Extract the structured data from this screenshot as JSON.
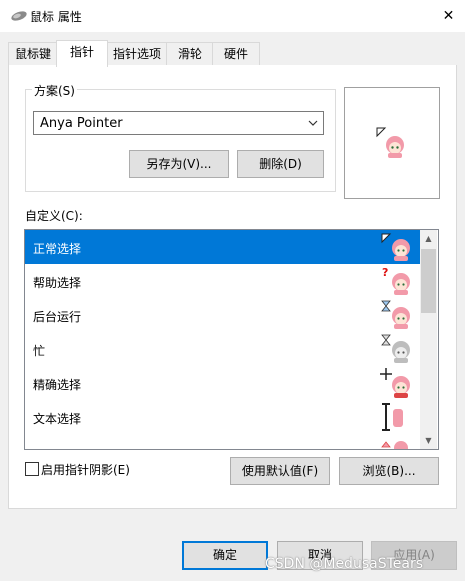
{
  "window": {
    "title": "鼠标 属性",
    "close_glyph": "✕"
  },
  "tabs": [
    {
      "label": "鼠标键",
      "active": false
    },
    {
      "label": "指针",
      "active": true
    },
    {
      "label": "指针选项",
      "active": false
    },
    {
      "label": "滑轮",
      "active": false
    },
    {
      "label": "硬件",
      "active": false
    }
  ],
  "scheme": {
    "label": "方案(S)",
    "selected": "Anya Pointer",
    "save_as": "另存为(V)...",
    "delete": "删除(D)"
  },
  "custom": {
    "label": "自定义(C):",
    "items": [
      {
        "label": "正常选择",
        "selected": true,
        "cursor_icon": "arrow-pointer-icon"
      },
      {
        "label": "帮助选择",
        "selected": false,
        "cursor_icon": "help-pointer-icon"
      },
      {
        "label": "后台运行",
        "selected": false,
        "cursor_icon": "working-in-background-icon"
      },
      {
        "label": "忙",
        "selected": false,
        "cursor_icon": "busy-icon"
      },
      {
        "label": "精确选择",
        "selected": false,
        "cursor_icon": "precision-select-icon"
      },
      {
        "label": "文本选择",
        "selected": false,
        "cursor_icon": "text-select-icon"
      }
    ]
  },
  "shadow": {
    "label": "启用指针阴影(E)",
    "checked": false
  },
  "buttons": {
    "use_default": "使用默认值(F)",
    "browse": "浏览(B)...",
    "ok": "确定",
    "cancel": "取消",
    "apply": "应用(A)"
  },
  "watermark": "CSDN @MedusaSTears",
  "colors": {
    "accent": "#0078d7",
    "avatar_hair": "#f29aa9"
  }
}
